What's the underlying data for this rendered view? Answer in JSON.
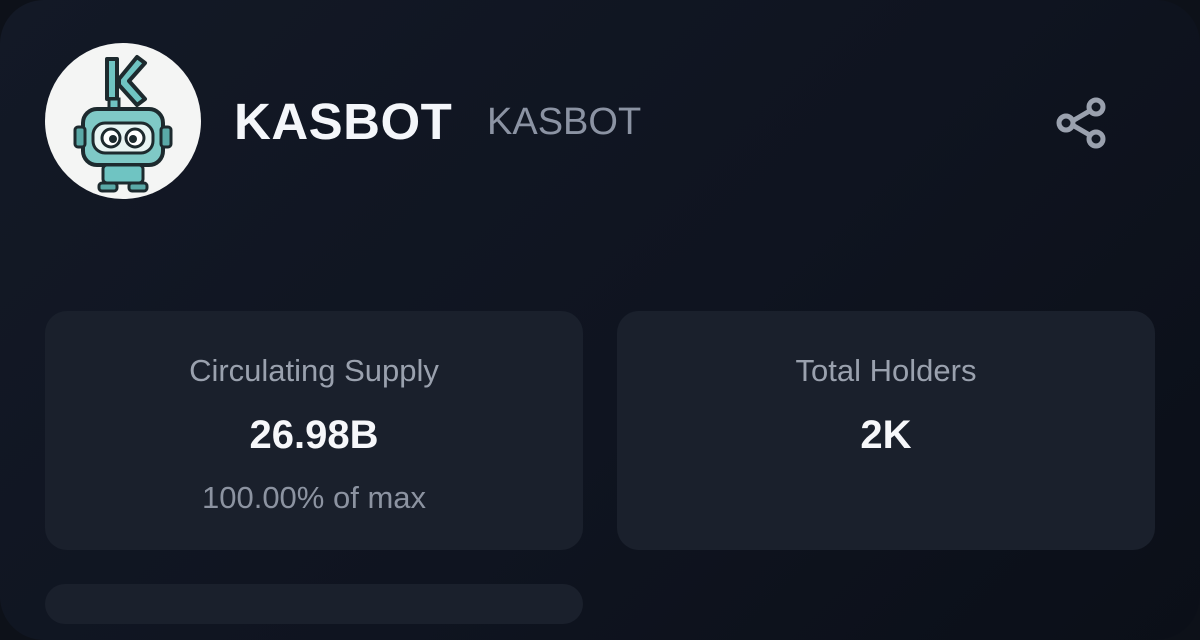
{
  "token": {
    "name": "KASBOT",
    "symbol": "KASBOT",
    "logo_icon": "kasbot-robot-logo",
    "share_icon": "share-icon"
  },
  "stats": [
    {
      "label": "Circulating Supply",
      "value": "26.98B",
      "sub": "100.00% of max"
    },
    {
      "label": "Total Holders",
      "value": "2K",
      "sub": ""
    }
  ],
  "colors": {
    "background": "#0d1119",
    "tile": "#1a202c",
    "text_primary": "#f4f6fa",
    "text_secondary": "#8b93a3",
    "logo_teal": "#5fb8b7"
  }
}
